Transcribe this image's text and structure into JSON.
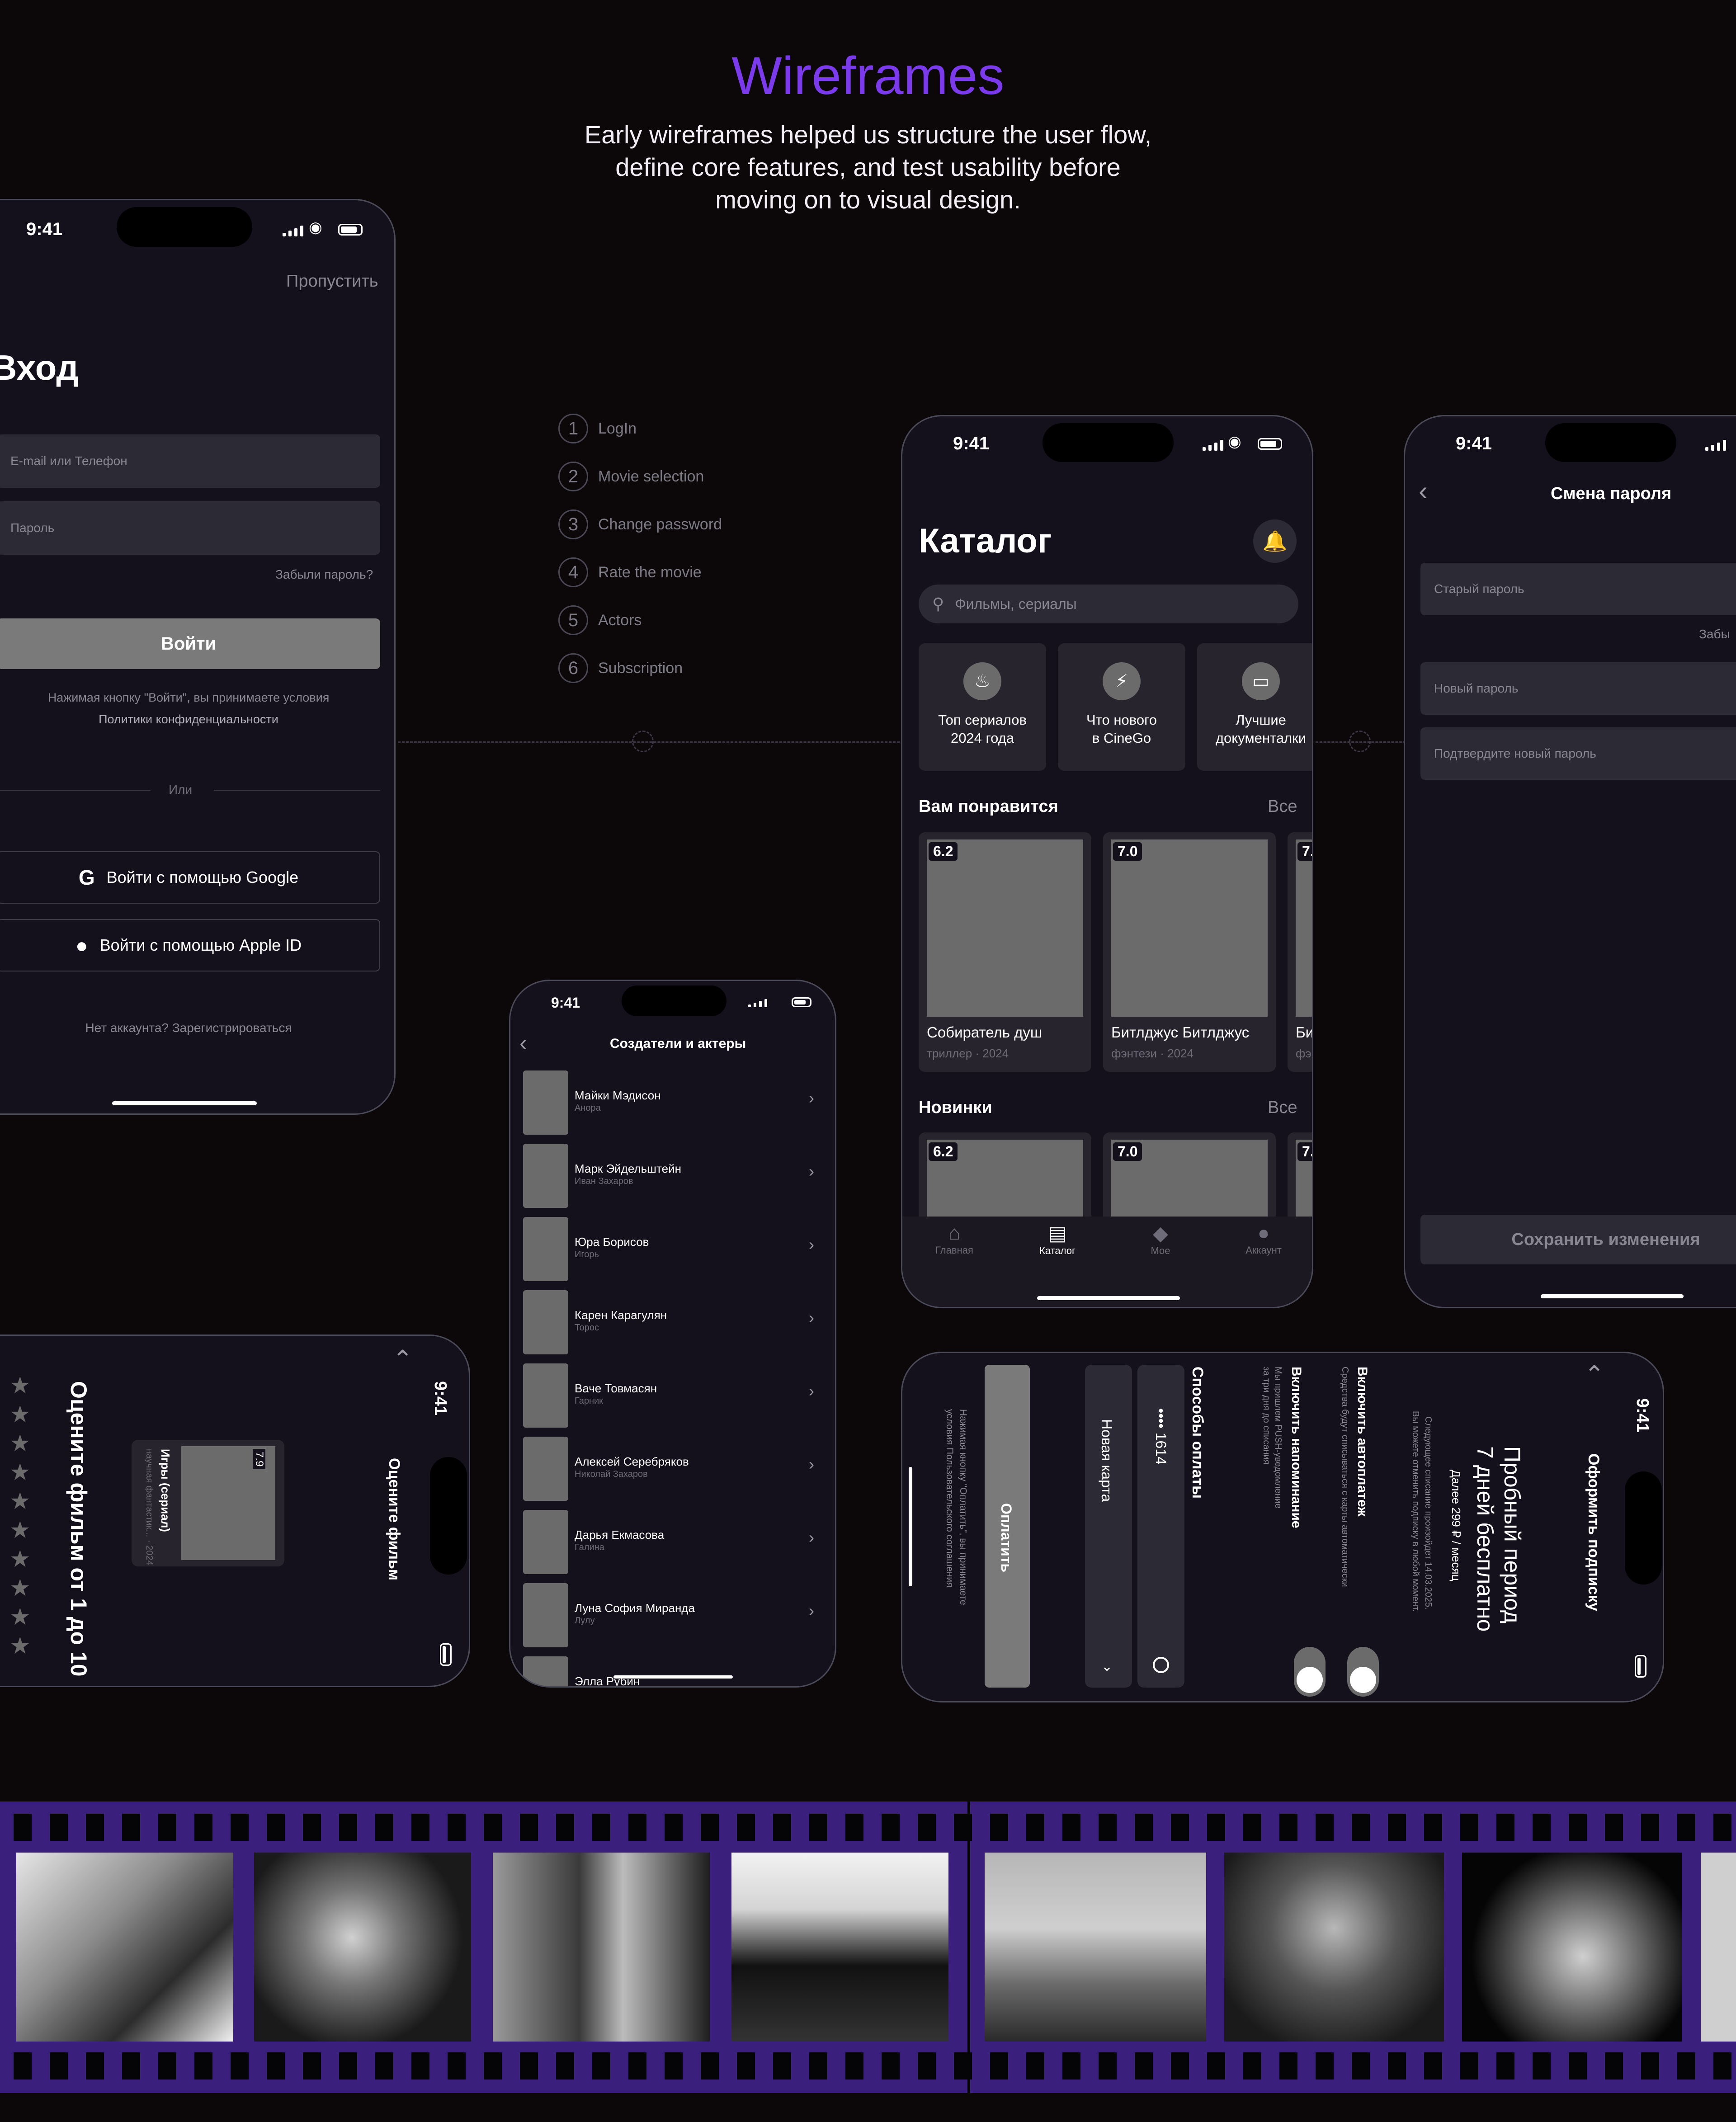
{
  "header": {
    "title": "Wireframes",
    "subtitle": "Early wireframes helped us structure the user flow, define core features, and test usability before moving on to visual design."
  },
  "steps": [
    {
      "num": "1",
      "label": "LogIn"
    },
    {
      "num": "2",
      "label": "Movie selection"
    },
    {
      "num": "3",
      "label": "Change password"
    },
    {
      "num": "4",
      "label": "Rate the movie"
    },
    {
      "num": "5",
      "label": "Actors"
    },
    {
      "num": "6",
      "label": "Subscription"
    }
  ],
  "status": {
    "time": "9:41"
  },
  "login": {
    "skip": "Пропустить",
    "title": "Вход",
    "email_placeholder": "E-mail или Телефон",
    "password_placeholder": "Пароль",
    "forgot": "Забыли пароль?",
    "login_btn": "Войти",
    "terms1": "Нажимая кнопку \"Войти\", вы принимаете условия",
    "terms2": "Политики конфиденциальности",
    "or": "Или",
    "google": "Войти с помощью Google",
    "apple": "Войти с помощью Apple ID",
    "no_account": "Нет аккаунта? Зарегистрироваться"
  },
  "catalog": {
    "title": "Каталог",
    "search_placeholder": "Фильмы, сериалы",
    "cats": [
      {
        "l1": "Топ сериалов",
        "l2": "2024 года"
      },
      {
        "l1": "Что нового",
        "l2": "в CineGo"
      },
      {
        "l1": "Лучшие",
        "l2": "документалки"
      }
    ],
    "sections": [
      {
        "title": "Вам понравится",
        "all": "Все"
      },
      {
        "title": "Новинки",
        "all": "Все"
      }
    ],
    "movies": [
      {
        "rating": "6.2",
        "title": "Собиратель душ",
        "meta": "триллер · 2024"
      },
      {
        "rating": "7.0",
        "title": "Битлджус Битлджус",
        "meta": "фэнтези · 2024"
      },
      {
        "rating": "7.",
        "title": "Би",
        "meta": "фэ"
      }
    ],
    "new_ratings": [
      "6.2",
      "7.0",
      "7."
    ],
    "tabs": [
      "Главная",
      "Каталог",
      "Мое",
      "Аккаунт"
    ]
  },
  "password": {
    "title": "Смена пароля",
    "old": "Старый пароль",
    "forgot": "Забы",
    "new": "Новый пароль",
    "confirm": "Подтвердите новый пароль",
    "save": "Сохранить изменения"
  },
  "actors": {
    "title": "Создатели и актеры",
    "list": [
      {
        "name": "Майки Мэдисон",
        "role": "Анора"
      },
      {
        "name": "Марк Эйдельштейн",
        "role": "Иван Захаров"
      },
      {
        "name": "Юра Борисов",
        "role": "Игорь"
      },
      {
        "name": "Карен Карагулян",
        "role": "Торос"
      },
      {
        "name": "Ваче Товмасян",
        "role": "Гарник"
      },
      {
        "name": "Алексей Серебряков",
        "role": "Николай Захаров"
      },
      {
        "name": "Дарья Екмасова",
        "role": "Галина"
      },
      {
        "name": "Луна София Миранда",
        "role": "Лулу"
      },
      {
        "name": "Элла Рубин",
        "role": ""
      }
    ]
  },
  "rate": {
    "header": "Оцените фильм",
    "prompt": "Оцените фильм от 1 до 10",
    "movie": "Игры (сериал)",
    "meta": "научная фантастик... · 2024",
    "rating": "7.9",
    "stars": 10
  },
  "subscription": {
    "header": "Оформить подписку",
    "trial1": "Пробный период",
    "trial2": "7 дней бесплатно",
    "price": "Далее 299 ₽ / месяц",
    "note1": "Следующее списание произойдет 14.03.2025.",
    "note2": "Вы можете отменить подписку в любой момент.",
    "autopay": "Включить автоплатеж",
    "autopay_desc": "Средства будут списываться с карты автоматически",
    "remind": "Включить напоминание",
    "remind_desc1": "Мы пришлем PUSH-уведомление",
    "remind_desc2": "за три дня до списания",
    "methods": "Способы оплаты",
    "card": "•••• 1614",
    "new_card": "Новая карта",
    "pay": "Оплатить",
    "terms1": "Нажимая кнопку \"Оплатить\", вы принимаете",
    "terms2": "условия Пользовательского соглашения"
  }
}
